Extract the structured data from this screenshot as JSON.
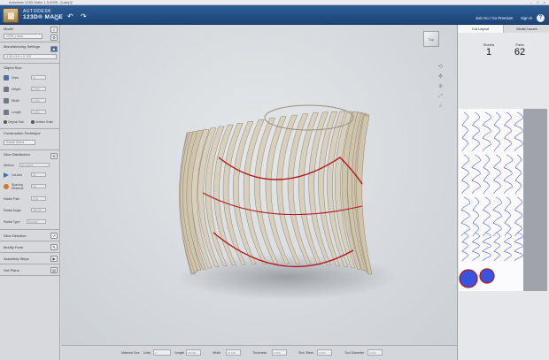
{
  "titlebar": {
    "title": "Autodesk 123D Make 1.5.0095 - [Lamp]*",
    "controls": "– □ ×"
  },
  "header": {
    "brand_line1": "AUTODESK",
    "brand_line2": "123D® MAKE",
    "dropdown_icon": "chevron-down-icon",
    "undo_icon": "undo-icon",
    "redo_icon": "redo-icon",
    "join_label": "Join Go / Go Premium",
    "signin_label": "Sign In",
    "help_label": "?"
  },
  "left_panel": {
    "model": {
      "title": "Model",
      "value": "123D_Lamp"
    },
    "manufacturing": {
      "title": "Manufacturing Settings",
      "value": "4.35 x 8.5 x 0.125"
    },
    "object_size": {
      "title": "Object Size",
      "units_label": "Units",
      "units_value": "in",
      "height_label": "Height",
      "height_value": "2.000",
      "width_label": "Width",
      "width_value": "2.000",
      "length_label": "Length",
      "length_value": "2.000",
      "original_size": "Original Size",
      "uniform_scale": "Uniform Scale"
    },
    "construction": {
      "title": "Construction Technique",
      "value": "Radial Slices"
    },
    "slice_distribution": {
      "title": "Slice Distribution",
      "method_label": "Method",
      "method_value": "By radius",
      "count_label": "1st Axis",
      "count_value": "22",
      "spacing_label": "Spacing",
      "spacing_label2": "Distance",
      "spacing_value": "45",
      "radial_path_label": "Radial Path",
      "radial_path_value": "0.00",
      "radial_angle_label": "Radial Angle",
      "radial_angle_value": "360.00",
      "slot_type_label": "Radial Type",
      "slot_type_value": "Normal"
    },
    "slice_direction": "Slice Direction",
    "modify_form": "Modify Form",
    "assembly_steps": "Assembly Steps",
    "get_plans": "Get Plans"
  },
  "viewport": {
    "viewcube_label": "Top",
    "tools": [
      "orbit-icon",
      "pan-icon",
      "zoom-icon",
      "fit-icon",
      "home-icon"
    ]
  },
  "bottombar": {
    "label": "Material Size",
    "units_label": "Units",
    "units_value": "in",
    "length_label": "Length",
    "length_value": "36.000",
    "width_label": "Width",
    "width_value": "24.000",
    "thickness_label": "Thickness",
    "thickness_value": "0.250",
    "slot_offset_label": "Slot Offset",
    "slot_offset_value": "0.000",
    "tool_diameter_label": "Tool Diameter",
    "tool_diameter_value": "0.000"
  },
  "right_panel": {
    "tab1": "Cut Layout",
    "tab2": "Model Issues",
    "sheets_label": "Sheets",
    "sheets_value": "1",
    "parts_label": "Parts",
    "parts_value": "62"
  },
  "colors": {
    "accent": "#1c4477",
    "slice_red": "#b4161b",
    "part_blue": "#3a52e0"
  }
}
